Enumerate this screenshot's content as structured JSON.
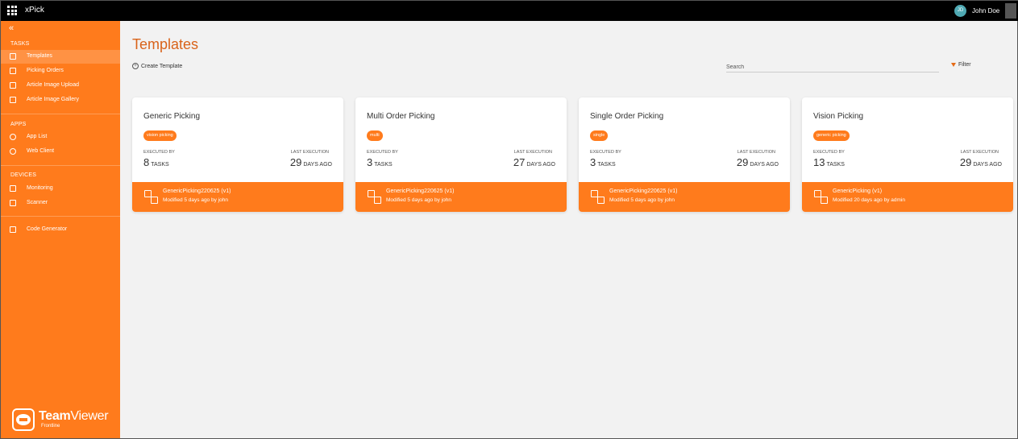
{
  "topbar": {
    "app_name": "xPick",
    "avatar_initials": "JD",
    "user_name": "John Doe",
    "icons": [
      "apps-grid-icon",
      "account-switch-icon"
    ]
  },
  "sidebar": {
    "sections": [
      {
        "title": "TASKS",
        "items": [
          {
            "label": "Templates",
            "icon": "templates-icon",
            "active": true
          },
          {
            "label": "Picking Orders",
            "icon": "list-icon"
          },
          {
            "label": "Article Image Upload",
            "icon": "document-icon"
          },
          {
            "label": "Article Image Gallery",
            "icon": "image-icon"
          }
        ]
      },
      {
        "title": "APPS",
        "items": [
          {
            "label": "App List",
            "icon": "app-list-icon"
          },
          {
            "label": "Web Client",
            "icon": "play-circle-icon"
          }
        ]
      },
      {
        "title": "DEVICES",
        "items": [
          {
            "label": "Monitoring",
            "icon": "monitoring-icon"
          },
          {
            "label": "Scanner",
            "icon": "scanner-icon"
          }
        ]
      }
    ],
    "extra_item": {
      "label": "Code Generator",
      "icon": "code-generator-icon"
    },
    "brand": {
      "name_bold": "Team",
      "name_light": "Viewer",
      "sub": "Frontline"
    }
  },
  "main": {
    "title": "Templates",
    "create_label": "Create Template",
    "search_placeholder": "Search",
    "filter_label": "Filter"
  },
  "card_labels": {
    "executed_by": "EXECUTED BY",
    "last_execution": "LAST EXECUTION",
    "tasks_unit": "TASKS",
    "days_unit": "DAYS AGO"
  },
  "cards": [
    {
      "title": "Generic Picking",
      "tag": "vision picking",
      "tasks": "8",
      "days": "29",
      "footer_name": "GenericPicking220625",
      "footer_version": "(v1)",
      "footer_modified": "Modified 5 days ago by john"
    },
    {
      "title": "Multi Order Picking",
      "tag": "multi",
      "tasks": "3",
      "days": "27",
      "footer_name": "GenericPicking220625",
      "footer_version": "(v1)",
      "footer_modified": "Modified 5 days ago by john"
    },
    {
      "title": "Single Order Picking",
      "tag": "single",
      "tasks": "3",
      "days": "29",
      "footer_name": "GenericPicking220625",
      "footer_version": "(v1)",
      "footer_modified": "Modified 5 days ago by john"
    },
    {
      "title": "Vision Picking",
      "tag": "generic picking",
      "tasks": "13",
      "days": "29",
      "footer_name": "GenericPicking",
      "footer_version": "(v1)",
      "footer_modified": "Modified 20 days ago by admin"
    }
  ],
  "colors": {
    "accent": "#ff7b1c",
    "title": "#d9631a",
    "topbar": "#000000",
    "background": "#f2f2f2"
  }
}
